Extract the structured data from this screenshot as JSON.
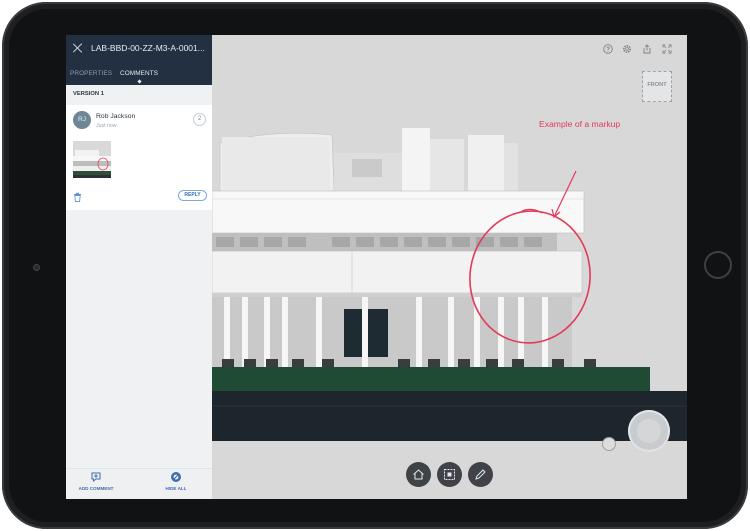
{
  "panel": {
    "title": "LAB-BBD-00-ZZ-M3-A-0001...",
    "tabs": [
      {
        "label": "PROPERTIES",
        "active": false
      },
      {
        "label": "COMMENTS",
        "active": true
      }
    ],
    "version_label": "VERSION 1",
    "comment": {
      "avatar_initials": "RJ",
      "author": "Rob Jackson",
      "time": "Just now",
      "count": "2",
      "reply_label": "REPLY"
    },
    "footer": {
      "add_comment": "ADD COMMENT",
      "hide_all": "HIDE ALL"
    }
  },
  "viewer": {
    "viewcube_label": "FRONT",
    "markup_annotation": "Example of a markup",
    "top_icons": [
      "help-icon",
      "settings-icon",
      "share-icon",
      "fullscreen-icon"
    ],
    "bottom_tools": [
      "home-icon",
      "fit-view-icon",
      "markup-pen-icon"
    ],
    "markup_color": "#e23a5a"
  },
  "colors": {
    "header_bg": "#233041",
    "accent_blue": "#3f6eb0",
    "device_frame": "#1e1f21"
  }
}
